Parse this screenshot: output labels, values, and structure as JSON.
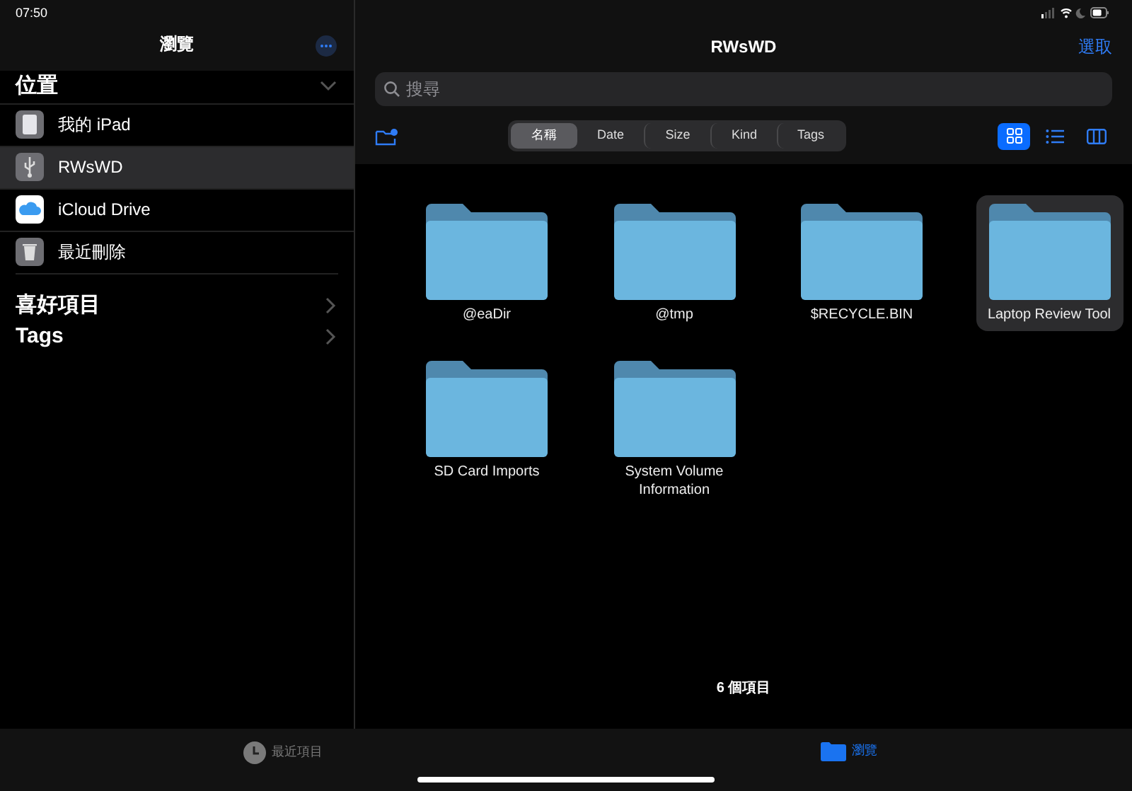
{
  "status_bar": {
    "time": "07:50"
  },
  "sidebar": {
    "title": "瀏覽",
    "sections": [
      {
        "title": "位置",
        "expanded": true,
        "items": [
          {
            "kind": "ipad",
            "label": "我的 iPad",
            "selected": false
          },
          {
            "kind": "usb",
            "label": "RWsWD",
            "selected": true
          },
          {
            "kind": "icloud",
            "label": "iCloud Drive",
            "selected": false
          },
          {
            "kind": "trash",
            "label": "最近刪除",
            "selected": false
          }
        ]
      },
      {
        "title": "喜好項目",
        "expanded": false
      },
      {
        "title": "Tags",
        "expanded": false
      }
    ]
  },
  "main": {
    "title": "RWsWD",
    "select_button": "選取",
    "search": {
      "placeholder": "搜尋"
    },
    "sort_tabs": [
      {
        "label": "名稱",
        "selected": true
      },
      {
        "label": "Date",
        "selected": false
      },
      {
        "label": "Size",
        "selected": false
      },
      {
        "label": "Kind",
        "selected": false
      },
      {
        "label": "Tags",
        "selected": false
      }
    ],
    "view_buttons": [
      {
        "kind": "grid",
        "selected": true
      },
      {
        "kind": "list",
        "selected": false
      },
      {
        "kind": "columns",
        "selected": false
      }
    ],
    "folders": [
      {
        "name": "@eaDir",
        "selected": false
      },
      {
        "name": "@tmp",
        "selected": false
      },
      {
        "name": "$RECYCLE.BIN",
        "selected": false
      },
      {
        "name": "Laptop Review Tool",
        "selected": true
      },
      {
        "name": "SD Card Imports",
        "selected": false
      },
      {
        "name": "System Volume Information",
        "selected": false
      }
    ],
    "item_count": "6 個項目"
  },
  "tab_bar": [
    {
      "kind": "recent",
      "label": "最近項目",
      "selected": false
    },
    {
      "kind": "browse",
      "label": "瀏覽",
      "selected": true
    }
  ]
}
